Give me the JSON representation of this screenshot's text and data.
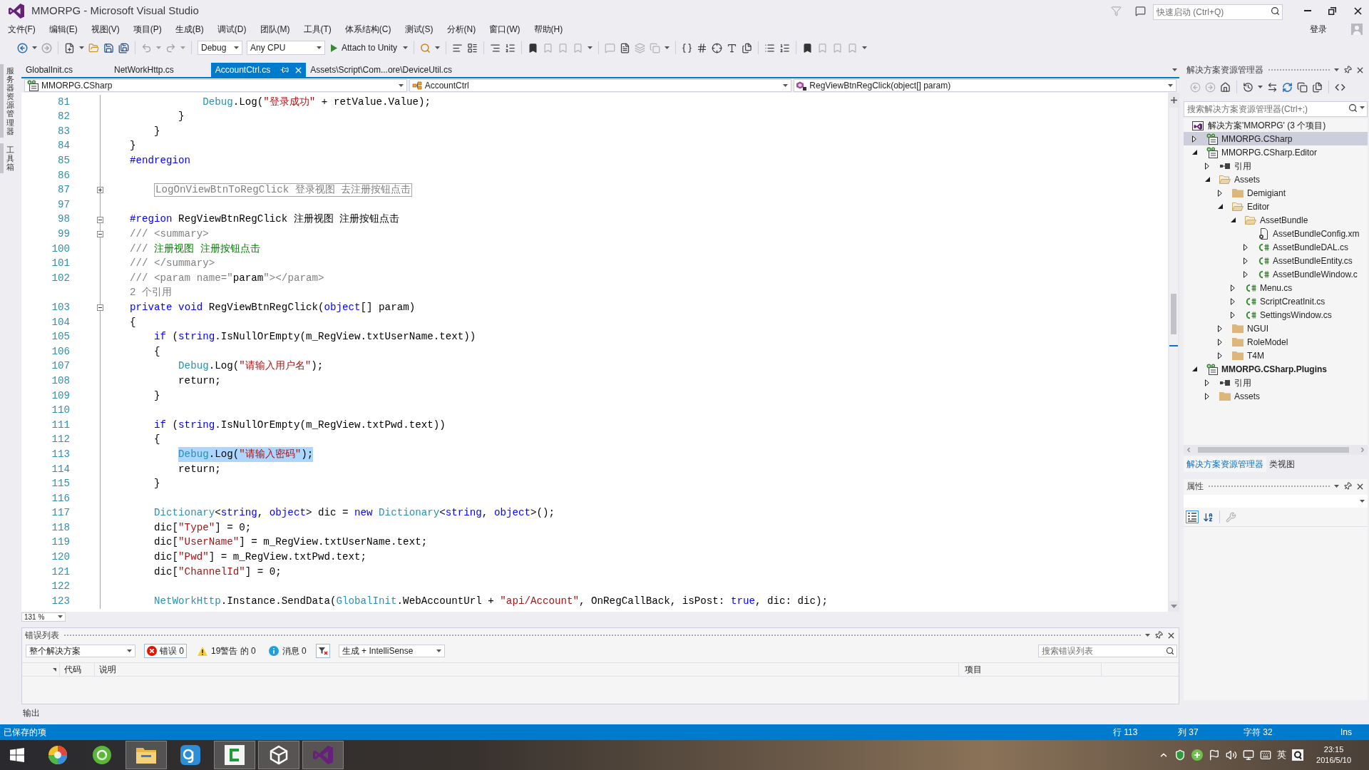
{
  "window": {
    "title": "MMORPG - Microsoft Visual Studio",
    "quick_launch": {
      "placeholder": "快速启动 (Ctrl+Q)"
    },
    "sign_in": "登录"
  },
  "menu": [
    "文件(F)",
    "编辑(E)",
    "视图(V)",
    "项目(P)",
    "生成(B)",
    "调试(D)",
    "团队(M)",
    "工具(T)",
    "体系结构(C)",
    "测试(S)",
    "分析(N)",
    "窗口(W)",
    "帮助(H)"
  ],
  "toolbar": {
    "configuration": "Debug",
    "platform": "Any CPU",
    "run_button": "Attach to Unity"
  },
  "side_tabs": [
    "服务器资源管理器",
    "工具箱"
  ],
  "document_tabs": [
    {
      "label": "GlobalInit.cs",
      "selected": false
    },
    {
      "label": "NetWorkHttp.cs",
      "selected": false
    },
    {
      "label": "AccountCtrl.cs",
      "selected": true
    },
    {
      "label": "Assets\\Script\\Com...ore\\DeviceUtil.cs",
      "selected": false
    }
  ],
  "navigation_bar": {
    "project": "MMORPG.CSharp",
    "type": "AccountCtrl",
    "member": "RegViewBtnRegClick(object[] param)"
  },
  "editor": {
    "zoom": "131 %",
    "lines": [
      {
        "kind": "code",
        "number": "81",
        "selected": false,
        "tokens": [
          {
            "kind": "type",
            "text": "            Debug"
          },
          {
            "kind": "plain",
            "text": ".Log("
          },
          {
            "kind": "string",
            "text": "\"登录成功\""
          },
          {
            "kind": "plain",
            "text": " + retValue.Value);"
          }
        ]
      },
      {
        "kind": "code",
        "number": "82",
        "selected": false,
        "tokens": [
          {
            "kind": "plain",
            "text": "        }"
          }
        ]
      },
      {
        "kind": "code",
        "number": "83",
        "selected": false,
        "tokens": [
          {
            "kind": "plain",
            "text": "    }"
          }
        ]
      },
      {
        "kind": "code",
        "number": "84",
        "selected": false,
        "tokens": [
          {
            "kind": "plain",
            "text": "}"
          }
        ]
      },
      {
        "kind": "code",
        "number": "85",
        "selected": false,
        "tokens": [
          {
            "kind": "preprocessor",
            "text": "#endregion"
          }
        ]
      },
      {
        "kind": "code",
        "number": "86",
        "selected": false
      },
      {
        "kind": "code",
        "number": "87",
        "selected": false,
        "folded": true,
        "tokens": [
          {
            "kind": "collapsed",
            "text": "    LogOnViewBtnToRegClick 登录视图 去注册按钮点击"
          }
        ]
      },
      {
        "kind": "code",
        "number": "97",
        "selected": false
      },
      {
        "kind": "code",
        "number": "98",
        "selected": false,
        "folded": false,
        "tokens": [
          {
            "kind": "preprocessor",
            "text": "#region"
          },
          {
            "kind": "plain",
            "text": " RegViewBtnRegClick 注册视图 注册按钮点击"
          }
        ]
      },
      {
        "kind": "code",
        "number": "99",
        "selected": false,
        "folded": false,
        "tokens": [
          {
            "kind": "doc",
            "text": "/// <summary>"
          }
        ]
      },
      {
        "kind": "code",
        "number": "100",
        "selected": false,
        "tokens": [
          {
            "kind": "doc",
            "text": "/// "
          },
          {
            "kind": "doc_text",
            "text": "注册视图 注册按钮点击"
          }
        ]
      },
      {
        "kind": "code",
        "number": "101",
        "selected": false,
        "tokens": [
          {
            "kind": "doc",
            "text": "/// </summary>"
          }
        ]
      },
      {
        "kind": "code",
        "number": "102",
        "selected": false,
        "tokens": [
          {
            "kind": "doc",
            "text": "/// <param name=\""
          },
          {
            "kind": "plain",
            "text": "param"
          },
          {
            "kind": "doc",
            "text": "\"></param>"
          }
        ]
      },
      {
        "kind": "codelens",
        "text": "2 个引用",
        "selected": false
      },
      {
        "kind": "code",
        "number": "103",
        "selected": false,
        "folded": false,
        "tokens": [
          {
            "kind": "keyword",
            "text": "private"
          },
          {
            "kind": "keyword",
            "text": " void"
          },
          {
            "kind": "plain",
            "text": " RegViewBtnRegClick("
          },
          {
            "kind": "keyword",
            "text": "object"
          },
          {
            "kind": "plain",
            "text": "[] param)"
          }
        ]
      },
      {
        "kind": "code",
        "number": "104",
        "selected": false,
        "tokens": [
          {
            "kind": "plain",
            "text": "{"
          }
        ]
      },
      {
        "kind": "code",
        "number": "105",
        "selected": false,
        "tokens": [
          {
            "kind": "keyword",
            "text": "    if"
          },
          {
            "kind": "plain",
            "text": " ("
          },
          {
            "kind": "keyword",
            "text": "string"
          },
          {
            "kind": "plain",
            "text": ".IsNullOrEmpty(m_RegView.txtUserName.text))"
          }
        ]
      },
      {
        "kind": "code",
        "number": "106",
        "selected": false,
        "tokens": [
          {
            "kind": "plain",
            "text": "    {"
          }
        ]
      },
      {
        "kind": "code",
        "number": "107",
        "selected": false,
        "tokens": [
          {
            "kind": "type",
            "text": "        Debug"
          },
          {
            "kind": "plain",
            "text": ".Log("
          },
          {
            "kind": "string",
            "text": "\"请输入用户名\""
          },
          {
            "kind": "plain",
            "text": ");"
          }
        ]
      },
      {
        "kind": "code",
        "number": "108",
        "selected": false,
        "tokens": [
          {
            "kind": "plain",
            "text": "        return;"
          }
        ]
      },
      {
        "kind": "code",
        "number": "109",
        "selected": false,
        "tokens": [
          {
            "kind": "plain",
            "text": "    }"
          }
        ]
      },
      {
        "kind": "code",
        "number": "110",
        "selected": false
      },
      {
        "kind": "code",
        "number": "111",
        "selected": false,
        "tokens": [
          {
            "kind": "keyword",
            "text": "    if"
          },
          {
            "kind": "plain",
            "text": " ("
          },
          {
            "kind": "keyword",
            "text": "string"
          },
          {
            "kind": "plain",
            "text": ".IsNullOrEmpty(m_RegView.txtPwd.text))"
          }
        ]
      },
      {
        "kind": "code",
        "number": "112",
        "selected": false,
        "tokens": [
          {
            "kind": "plain",
            "text": "    {"
          }
        ]
      },
      {
        "kind": "code",
        "number": "113",
        "selected": true,
        "tokens": [
          {
            "kind": "type",
            "text": "        Debug"
          },
          {
            "kind": "plain",
            "text": ".Log("
          },
          {
            "kind": "string",
            "text": "\"请输入密码\""
          },
          {
            "kind": "plain",
            "text": ");"
          }
        ]
      },
      {
        "kind": "code",
        "number": "114",
        "selected": false,
        "tokens": [
          {
            "kind": "plain",
            "text": "        return;"
          }
        ]
      },
      {
        "kind": "code",
        "number": "115",
        "selected": false,
        "tokens": [
          {
            "kind": "plain",
            "text": "    }"
          }
        ]
      },
      {
        "kind": "code",
        "number": "116",
        "selected": false
      },
      {
        "kind": "code",
        "number": "117",
        "selected": false,
        "tokens": [
          {
            "kind": "type",
            "text": "    Dictionary"
          },
          {
            "kind": "plain",
            "text": "<"
          },
          {
            "kind": "keyword",
            "text": "string"
          },
          {
            "kind": "plain",
            "text": ", "
          },
          {
            "kind": "keyword",
            "text": "object"
          },
          {
            "kind": "plain",
            "text": "> dic = "
          },
          {
            "kind": "keyword",
            "text": "new"
          },
          {
            "kind": "type",
            "text": " Dictionary"
          },
          {
            "kind": "plain",
            "text": "<"
          },
          {
            "kind": "keyword",
            "text": "string"
          },
          {
            "kind": "plain",
            "text": ", "
          },
          {
            "kind": "keyword",
            "text": "object"
          },
          {
            "kind": "plain",
            "text": ">();"
          }
        ]
      },
      {
        "kind": "code",
        "number": "118",
        "selected": false,
        "tokens": [
          {
            "kind": "plain",
            "text": "    dic["
          },
          {
            "kind": "string",
            "text": "\"Type\""
          },
          {
            "kind": "plain",
            "text": "] = 0;"
          }
        ]
      },
      {
        "kind": "code",
        "number": "119",
        "selected": false,
        "tokens": [
          {
            "kind": "plain",
            "text": "    dic["
          },
          {
            "kind": "string",
            "text": "\"UserName\""
          },
          {
            "kind": "plain",
            "text": "] = m_RegView.txtUserName.text;"
          }
        ]
      },
      {
        "kind": "code",
        "number": "120",
        "selected": false,
        "tokens": [
          {
            "kind": "plain",
            "text": "    dic["
          },
          {
            "kind": "string",
            "text": "\"Pwd\""
          },
          {
            "kind": "plain",
            "text": "] = m_RegView.txtPwd.text;"
          }
        ]
      },
      {
        "kind": "code",
        "number": "121",
        "selected": false,
        "tokens": [
          {
            "kind": "plain",
            "text": "    dic["
          },
          {
            "kind": "string",
            "text": "\"ChannelId\""
          },
          {
            "kind": "plain",
            "text": "] = 0;"
          }
        ]
      },
      {
        "kind": "code",
        "number": "122",
        "selected": false
      },
      {
        "kind": "code",
        "number": "123",
        "selected": false,
        "tokens": [
          {
            "kind": "type",
            "text": "    NetWorkHttp"
          },
          {
            "kind": "plain",
            "text": ".Instance.SendData("
          },
          {
            "kind": "type",
            "text": "GlobalInit"
          },
          {
            "kind": "plain",
            "text": ".WebAccountUrl + "
          },
          {
            "kind": "string",
            "text": "\"api/Account\""
          },
          {
            "kind": "plain",
            "text": ", OnRegCallBack, isPost: "
          },
          {
            "kind": "keyword",
            "text": "true"
          },
          {
            "kind": "plain",
            "text": ", dic: dic);"
          }
        ]
      }
    ]
  },
  "error_list": {
    "title": "错误列表",
    "scope": "整个解决方案",
    "errors": "错误 0",
    "warnings": "19警告 的 0",
    "messages": "消息 0",
    "source": "生成 + IntelliSense",
    "search": {
      "placeholder": "搜索错误列表"
    },
    "columns": [
      "代码",
      "说明",
      "项目"
    ]
  },
  "output_tab": "输出",
  "solution_explorer": {
    "title": "解决方案资源管理器",
    "search": {
      "placeholder": "搜索解决方案资源管理器(Ctrl+;)"
    },
    "tree": [
      {
        "label": "解决方案'MMORPG' (3 个项目)",
        "kind": "solution",
        "selected": false
      },
      {
        "label": "MMORPG.CSharp",
        "kind": "project",
        "bold": false,
        "expanded": false,
        "selected": true
      },
      {
        "label": "MMORPG.CSharp.Editor",
        "kind": "project",
        "bold": false,
        "expanded": true,
        "selected": false,
        "children": [
          {
            "label": "引用",
            "kind": "references",
            "expanded": false,
            "selected": false
          },
          {
            "label": "Assets",
            "kind": "folder",
            "expanded": true,
            "selected": false,
            "children": [
              {
                "label": "Demigiant",
                "kind": "folder",
                "expanded": false,
                "selected": false
              },
              {
                "label": "Editor",
                "kind": "folder",
                "expanded": true,
                "selected": false,
                "children": [
                  {
                    "label": "AssetBundle",
                    "kind": "folder",
                    "expanded": true,
                    "selected": false,
                    "children": [
                      {
                        "label": "AssetBundleConfig.xm",
                        "kind": "xml",
                        "selected": false
                      },
                      {
                        "label": "AssetBundleDAL.cs",
                        "kind": "csharp",
                        "expanded": false,
                        "selected": false
                      },
                      {
                        "label": "AssetBundleEntity.cs",
                        "kind": "csharp",
                        "expanded": false,
                        "selected": false
                      },
                      {
                        "label": "AssetBundleWindow.c",
                        "kind": "csharp",
                        "expanded": false,
                        "selected": false
                      }
                    ]
                  },
                  {
                    "label": "Menu.cs",
                    "kind": "csharp",
                    "expanded": false,
                    "selected": false
                  },
                  {
                    "label": "ScriptCreatInit.cs",
                    "kind": "csharp",
                    "expanded": false,
                    "selected": false
                  },
                  {
                    "label": "SettingsWindow.cs",
                    "kind": "csharp",
                    "expanded": false,
                    "selected": false
                  }
                ]
              },
              {
                "label": "NGUI",
                "kind": "folder",
                "expanded": false,
                "selected": false
              },
              {
                "label": "RoleModel",
                "kind": "folder",
                "expanded": false,
                "selected": false
              },
              {
                "label": "T4M",
                "kind": "folder",
                "expanded": false,
                "selected": false
              }
            ]
          }
        ]
      },
      {
        "label": "MMORPG.CSharp.Plugins",
        "kind": "project",
        "bold": true,
        "expanded": true,
        "selected": false,
        "children": [
          {
            "label": "引用",
            "kind": "references",
            "expanded": false,
            "selected": false
          },
          {
            "label": "Assets",
            "kind": "folder",
            "expanded": false,
            "selected": false
          }
        ]
      }
    ],
    "tabs": [
      {
        "label": "解决方案资源管理器",
        "selected": true
      },
      {
        "label": "类视图",
        "selected": false
      }
    ]
  },
  "properties": {
    "title": "属性"
  },
  "status_bar": {
    "message": "已保存的项",
    "line": "行 113",
    "column": "列 37",
    "character": "字符 32",
    "mode": "Ins"
  },
  "taskbar": {
    "apps": [
      {
        "kind": "color_ball",
        "running": false
      },
      {
        "kind": "ring",
        "running": false
      },
      {
        "kind": "file_explorer",
        "running": true
      },
      {
        "kind": "app_tile",
        "running": false
      },
      {
        "kind": "bracket",
        "running": true
      },
      {
        "kind": "cube",
        "running": true
      },
      {
        "kind": "ribbon",
        "running": true
      }
    ],
    "ime": "英",
    "time": "23:15",
    "date": "2016/5/10"
  }
}
